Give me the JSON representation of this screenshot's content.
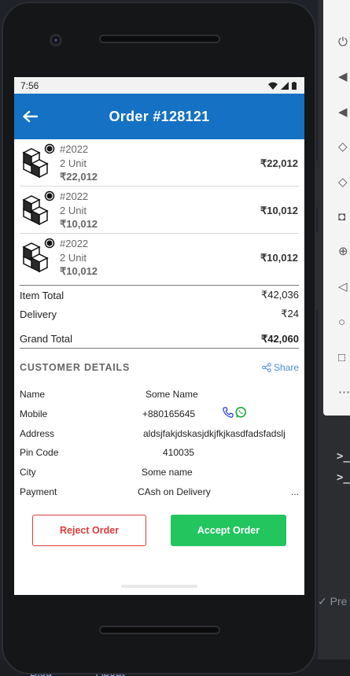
{
  "status_bar": {
    "time": "7:56"
  },
  "app_bar": {
    "title": "Order #128121"
  },
  "items": [
    {
      "code": "#2022",
      "unit": "2 Unit",
      "price": "₹22,012",
      "total": "₹22,012"
    },
    {
      "code": "#2022",
      "unit": "2 Unit",
      "price": "₹10,012",
      "total": "₹10,012"
    },
    {
      "code": "#2022",
      "unit": "2 Unit",
      "price": "₹10,012",
      "total": "₹10,012"
    }
  ],
  "totals": {
    "item_total_label": "Item Total",
    "item_total_value": "₹42,036",
    "delivery_label": "Delivery",
    "delivery_value": "₹24",
    "grand_total_label": "Grand Total",
    "grand_total_value": "₹42,060"
  },
  "customer": {
    "section_title": "CUSTOMER DETAILS",
    "share_label": "Share",
    "rows": [
      {
        "label": "Name",
        "value": "Some Name"
      },
      {
        "label": "Mobile",
        "value": "+880165645"
      },
      {
        "label": "Address",
        "value": "aldsjfakjdskasjdkjfkjkasdfadsfadslj"
      },
      {
        "label": "Pin Code",
        "value": "410035"
      },
      {
        "label": "City",
        "value": "Some name"
      },
      {
        "label": "Payment",
        "value": "CAsh on Delivery",
        "extra": "..."
      }
    ]
  },
  "actions": {
    "reject_label": "Reject Order",
    "accept_label": "Accept Order"
  },
  "desktop": {
    "preview_label": "Pre",
    "blog_link": "Blog",
    "about_link": "About",
    "prompt_glyph": ">_"
  },
  "colors": {
    "app_bar": "#1471c3",
    "accept": "#22c55e",
    "reject": "#e03b3b",
    "share": "#4a8fd6"
  }
}
